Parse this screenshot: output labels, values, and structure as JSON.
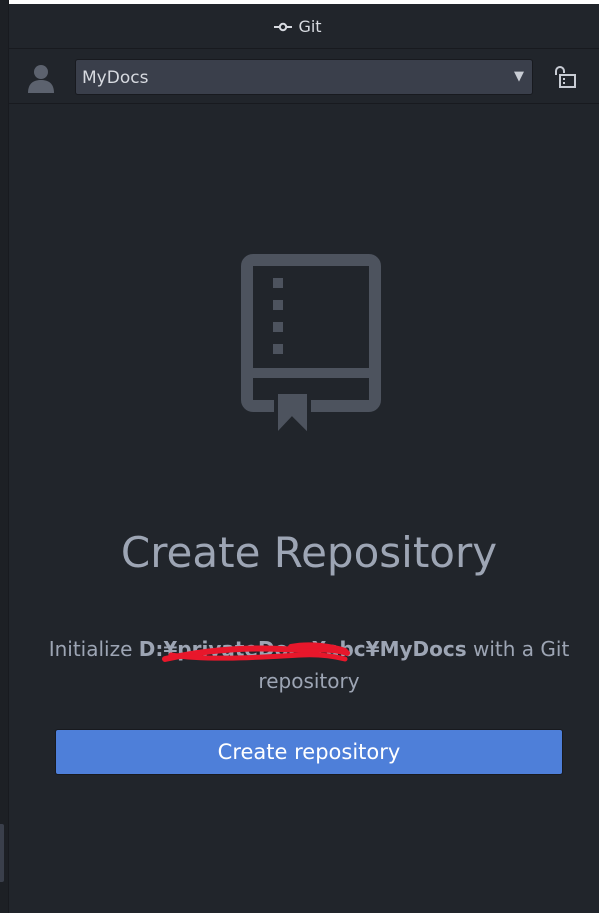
{
  "panel": {
    "title": "Git",
    "title_icon": "git-commit-icon"
  },
  "toolbar": {
    "avatar_icon": "user-avatar-icon",
    "repository_select": {
      "value": "MyDocs",
      "caret_icon": "triangle-down-icon"
    },
    "lock_icon": "unlock-icon"
  },
  "empty_state": {
    "icon": "repository-book-icon",
    "heading": "Create Repository",
    "description_prefix": "Initialize ",
    "description_path": "D:¥privateDocs¥abc¥MyDocs",
    "description_suffix": " with a Git repository",
    "button_label": "Create repository"
  },
  "colors": {
    "background": "#21252b",
    "input_background": "#3a3f4b",
    "text_muted": "#9da5b4",
    "icon": "#4d535e",
    "accent": "#4e7fd9",
    "redaction": "#e8172b"
  }
}
